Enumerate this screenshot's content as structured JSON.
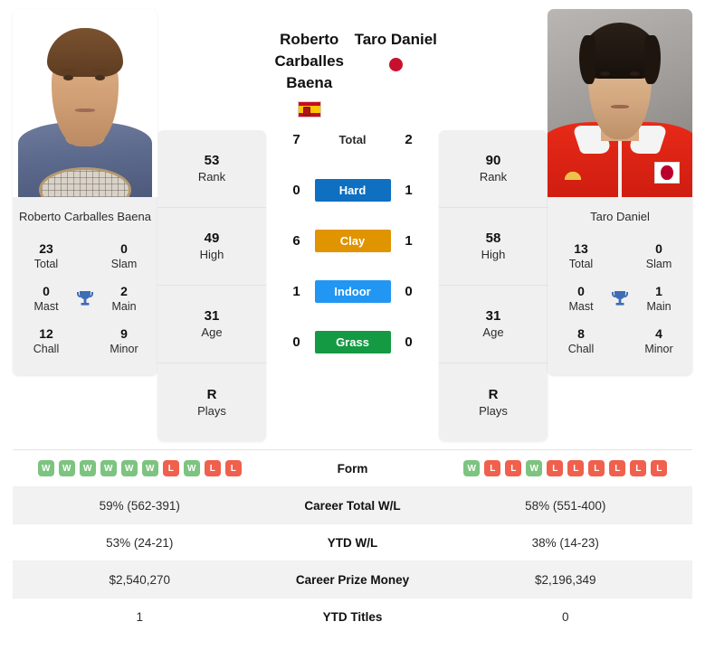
{
  "players": {
    "left": {
      "name": "Roberto Carballes Baena",
      "name_line1": "Roberto",
      "name_line2": "Carballes Baena",
      "flag": "spain-flag",
      "card_name": "Roberto Carballes Baena",
      "titles": [
        {
          "num": "23",
          "label": "Total"
        },
        {
          "num": "0",
          "label": "Slam"
        },
        {
          "num": "0",
          "label": "Mast"
        },
        {
          "num": "2",
          "label": "Main"
        },
        {
          "num": "12",
          "label": "Chall"
        },
        {
          "num": "9",
          "label": "Minor"
        }
      ],
      "ranks": [
        {
          "num": "53",
          "label": "Rank"
        },
        {
          "num": "49",
          "label": "High"
        },
        {
          "num": "31",
          "label": "Age"
        },
        {
          "num": "R",
          "label": "Plays"
        }
      ],
      "form": [
        "W",
        "W",
        "W",
        "W",
        "W",
        "W",
        "L",
        "W",
        "L",
        "L"
      ],
      "career_total_wl": "59% (562-391)",
      "ytd_wl": "53% (24-21)",
      "career_prize_money": "$2,540,270",
      "ytd_titles": "1"
    },
    "right": {
      "name": "Taro Daniel",
      "name_line1": "Taro Daniel",
      "flag": "japan-flag",
      "card_name": "Taro Daniel",
      "titles": [
        {
          "num": "13",
          "label": "Total"
        },
        {
          "num": "0",
          "label": "Slam"
        },
        {
          "num": "0",
          "label": "Mast"
        },
        {
          "num": "1",
          "label": "Main"
        },
        {
          "num": "8",
          "label": "Chall"
        },
        {
          "num": "4",
          "label": "Minor"
        }
      ],
      "ranks": [
        {
          "num": "90",
          "label": "Rank"
        },
        {
          "num": "58",
          "label": "High"
        },
        {
          "num": "31",
          "label": "Age"
        },
        {
          "num": "R",
          "label": "Plays"
        }
      ],
      "form": [
        "W",
        "L",
        "L",
        "W",
        "L",
        "L",
        "L",
        "L",
        "L",
        "L"
      ],
      "career_total_wl": "58% (551-400)",
      "ytd_wl": "38% (14-23)",
      "career_prize_money": "$2,196,349",
      "ytd_titles": "0"
    }
  },
  "surfaces": [
    {
      "label": "Total",
      "left": "7",
      "right": "2",
      "color": "transparent",
      "plain": true
    },
    {
      "label": "Hard",
      "left": "0",
      "right": "1",
      "color": "#0f6fc0",
      "plain": false
    },
    {
      "label": "Clay",
      "left": "6",
      "right": "1",
      "color": "#e09400",
      "plain": false
    },
    {
      "label": "Indoor",
      "left": "1",
      "right": "0",
      "color": "#2196f3",
      "plain": false
    },
    {
      "label": "Grass",
      "left": "0",
      "right": "0",
      "color": "#139a43",
      "plain": false
    }
  ],
  "table_rows": [
    {
      "label": "Form",
      "type": "form"
    },
    {
      "label": "Career Total W/L",
      "type": "text",
      "key": "career_total_wl"
    },
    {
      "label": "YTD W/L",
      "type": "text",
      "key": "ytd_wl"
    },
    {
      "label": "Career Prize Money",
      "type": "text",
      "key": "career_prize_money"
    },
    {
      "label": "YTD Titles",
      "type": "text",
      "key": "ytd_titles"
    }
  ],
  "colors": {
    "hard": "#0f6fc0",
    "clay": "#e09400",
    "indoor": "#2196f3",
    "grass": "#139a43",
    "win": "#7cc47f",
    "loss": "#f0604d",
    "trophy": "#3d6db5",
    "panel": "#f0f0f0"
  }
}
